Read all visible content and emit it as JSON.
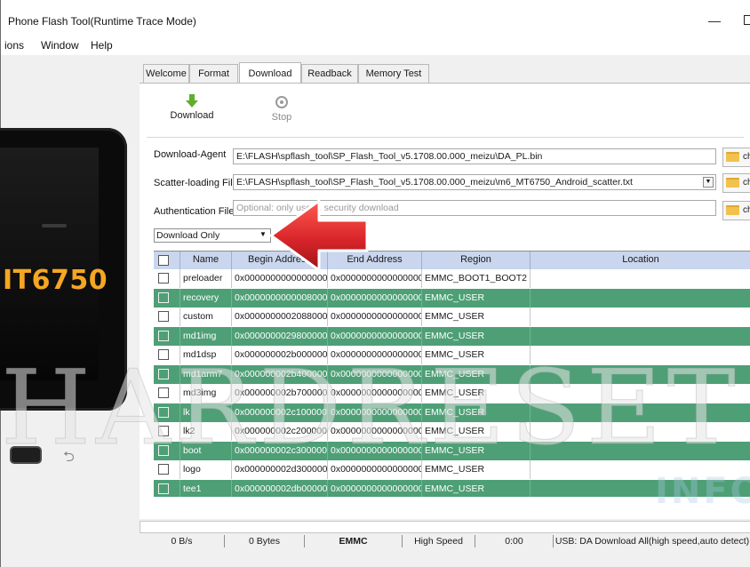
{
  "window": {
    "title": "Phone Flash Tool(Runtime Trace Mode)",
    "minimize_glyph": "—"
  },
  "menu": {
    "items": [
      "ions",
      "Window",
      "Help"
    ]
  },
  "phone_image": {
    "chip_text": "IT6750"
  },
  "tabs": [
    "Welcome",
    "Format",
    "Download",
    "Readback",
    "Memory Test"
  ],
  "active_tab": "Download",
  "toolbar": {
    "download_label": "Download",
    "stop_label": "Stop"
  },
  "fields": {
    "download_agent": {
      "label": "Download-Agent",
      "value": "E:\\FLASH\\spflash_tool\\SP_Flash_Tool_v5.1708.00.000_meizu\\DA_PL.bin",
      "button": "ch"
    },
    "scatter": {
      "label": "Scatter-loading File",
      "value": "E:\\FLASH\\spflash_tool\\SP_Flash_Tool_v5.1708.00.000_meizu\\m6_MT6750_Android_scatter.txt",
      "button": "ch"
    },
    "auth": {
      "label": "Authentication File",
      "placeholder": "Optional: only use ... security download",
      "button": "ch"
    }
  },
  "mode": {
    "selected": "Download Only"
  },
  "table": {
    "headers": [
      "Name",
      "Begin Address",
      "End Address",
      "Region",
      "Location"
    ],
    "rows": [
      {
        "name": "preloader",
        "begin": "0x0000000000000000",
        "end": "0x0000000000000000",
        "region": "EMMC_BOOT1_BOOT2",
        "style": "white"
      },
      {
        "name": "recovery",
        "begin": "0x0000000000008000",
        "end": "0x0000000000000000",
        "region": "EMMC_USER",
        "style": "green"
      },
      {
        "name": "custom",
        "begin": "0x0000000002088000",
        "end": "0x0000000000000000",
        "region": "EMMC_USER",
        "style": "white"
      },
      {
        "name": "md1img",
        "begin": "0x0000000029800000",
        "end": "0x0000000000000000",
        "region": "EMMC_USER",
        "style": "green"
      },
      {
        "name": "md1dsp",
        "begin": "0x000000002b000000",
        "end": "0x0000000000000000",
        "region": "EMMC_USER",
        "style": "white"
      },
      {
        "name": "md1arm7",
        "begin": "0x000000002b400000",
        "end": "0x0000000000000000",
        "region": "EMMC_USER",
        "style": "green"
      },
      {
        "name": "md3img",
        "begin": "0x000000002b700000",
        "end": "0x0000000000000000",
        "region": "EMMC_USER",
        "style": "white"
      },
      {
        "name": "lk",
        "begin": "0x000000002c100000",
        "end": "0x0000000000000000",
        "region": "EMMC_USER",
        "style": "green"
      },
      {
        "name": "lk2",
        "begin": "0x000000002c200000",
        "end": "0x0000000000000000",
        "region": "EMMC_USER",
        "style": "white"
      },
      {
        "name": "boot",
        "begin": "0x000000002c300000",
        "end": "0x0000000000000000",
        "region": "EMMC_USER",
        "style": "green"
      },
      {
        "name": "logo",
        "begin": "0x000000002d300000",
        "end": "0x0000000000000000",
        "region": "EMMC_USER",
        "style": "white"
      },
      {
        "name": "tee1",
        "begin": "0x000000002db00000",
        "end": "0x0000000000000000",
        "region": "EMMC_USER",
        "style": "green"
      }
    ]
  },
  "status": {
    "speed": "0 B/s",
    "bytes": "0 Bytes",
    "storage": "EMMC",
    "mode": "High Speed",
    "time": "0:00",
    "usb": "USB: DA Download All(high speed,auto detect)"
  },
  "watermark": {
    "main": "HARDRESET",
    "sub": "INFO"
  },
  "colors": {
    "row_green": "#4e9f76",
    "header_blue": "#c9d6ee",
    "arrow_red": "#d9262b",
    "chip_orange": "#f5a623"
  }
}
